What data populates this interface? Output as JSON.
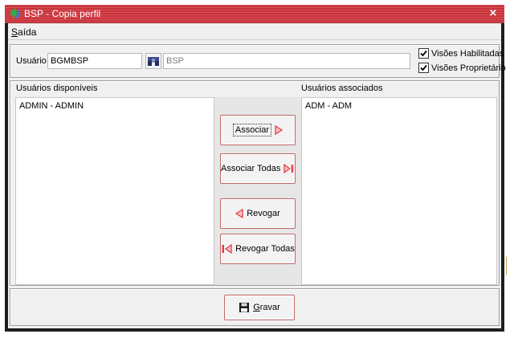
{
  "window": {
    "title": "BSP - Copia perfil",
    "close_label": "×"
  },
  "menu": {
    "items": [
      {
        "accel": "S",
        "rest": "aída"
      }
    ]
  },
  "user_panel": {
    "user_label": "Usuário",
    "user_value": "BGMBSP",
    "description_value": "BSP",
    "checkboxes": [
      {
        "label": "Visões Habilitadas",
        "checked": true
      },
      {
        "label": "Visões Proprietário",
        "checked": true
      }
    ]
  },
  "available": {
    "label": "Usuários disponíveis",
    "items": [
      "ADMIN - ADMIN"
    ]
  },
  "associated": {
    "label": "Usuários associados",
    "items": [
      "ADM - ADM"
    ]
  },
  "actions": {
    "associar": "Associar",
    "associar_todas": "Associar Todas",
    "revogar": "Revogar",
    "revogar_todas": "Revogar Todas"
  },
  "footer": {
    "gravar_accel": "G",
    "gravar_rest": "ravar"
  },
  "colors": {
    "titlebar": "#c8323a",
    "arrow": "#e0404a",
    "button_border": "#c06666"
  }
}
